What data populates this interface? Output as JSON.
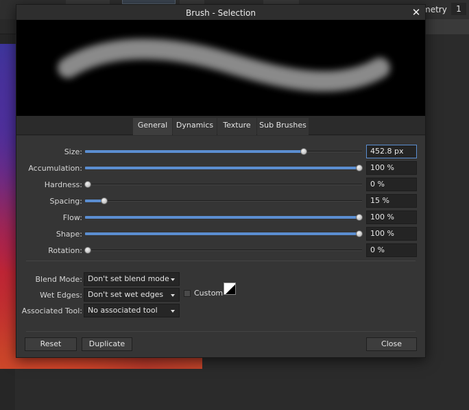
{
  "app": {
    "geometry_label": "metry",
    "geometry_value": "1"
  },
  "dialog": {
    "title": "Brush - Selection",
    "close_glyph": "✕"
  },
  "tabs": [
    {
      "label": "General",
      "active": true
    },
    {
      "label": "Dynamics",
      "active": false
    },
    {
      "label": "Texture",
      "active": false
    },
    {
      "label": "Sub Brushes",
      "active": false
    }
  ],
  "sliders": [
    {
      "label": "Size:",
      "value": "452.8 px",
      "fraction": 0.79
    },
    {
      "label": "Accumulation:",
      "value": "100 %",
      "fraction": 1.0
    },
    {
      "label": "Hardness:",
      "value": "0 %",
      "fraction": 0.0
    },
    {
      "label": "Spacing:",
      "value": "15 %",
      "fraction": 0.07
    },
    {
      "label": "Flow:",
      "value": "100 %",
      "fraction": 1.0
    },
    {
      "label": "Shape:",
      "value": "100 %",
      "fraction": 1.0
    },
    {
      "label": "Rotation:",
      "value": "0 %",
      "fraction": 0.0
    }
  ],
  "options": {
    "blend_mode_label": "Blend Mode:",
    "blend_mode_value": "Don't set blend mode",
    "wet_edges_label": "Wet Edges:",
    "wet_edges_value": "Don't set wet edges",
    "custom_label": "Custom",
    "assoc_tool_label": "Associated Tool:",
    "assoc_tool_value": "No associated tool"
  },
  "buttons": {
    "reset": "Reset",
    "duplicate": "Duplicate",
    "close": "Close"
  },
  "colors": {
    "accent": "#5b8ed1",
    "dialog_bg": "#353535"
  }
}
